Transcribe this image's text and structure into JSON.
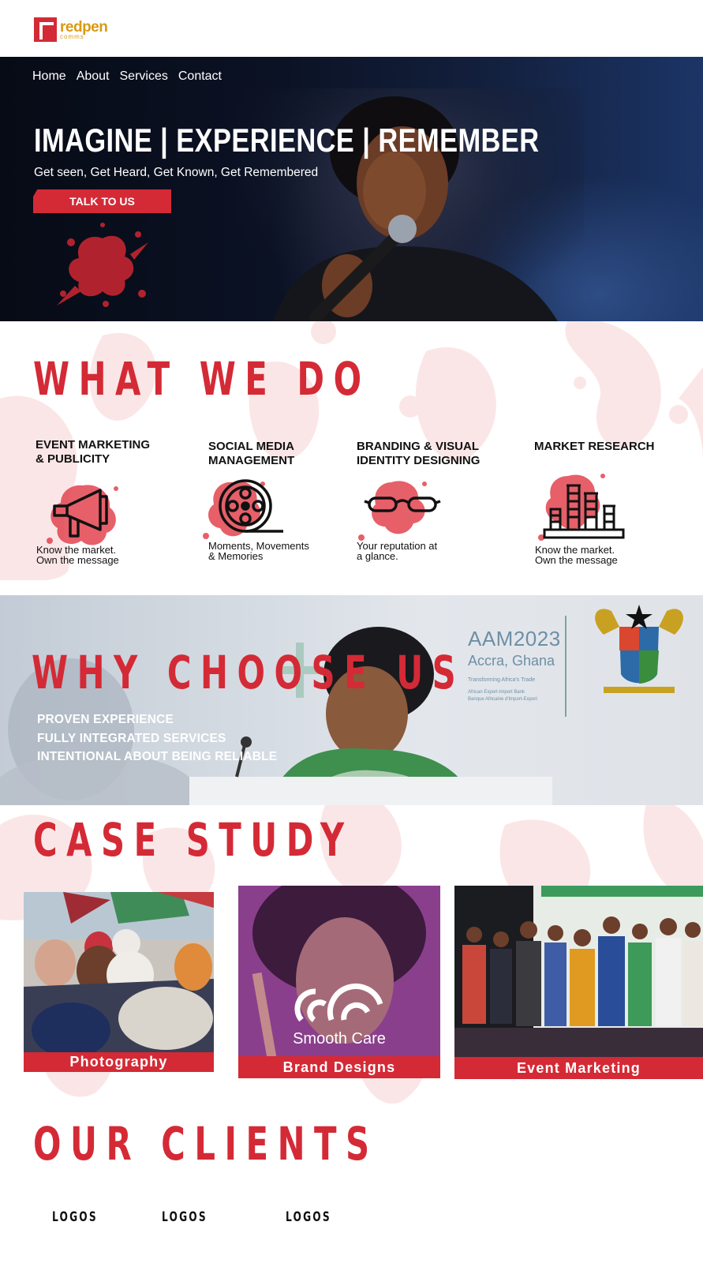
{
  "brand": {
    "logo_word": "redpen",
    "logo_sub": "comms"
  },
  "nav": {
    "items": [
      "Home",
      "About",
      "Services",
      "Contact"
    ]
  },
  "hero": {
    "title": "IMAGINE | EXPERIENCE | REMEMBER",
    "subtitle": "Get seen, Get Heard, Get Known, Get Remembered",
    "cta_label": "TALK TO US"
  },
  "what_we_do": {
    "title": "WHAT WE DO",
    "services": [
      {
        "title": "EVENT MARKETING\n& PUBLICITY",
        "icon": "megaphone-icon",
        "desc": "Know the market.\nOwn the message"
      },
      {
        "title": "SOCIAL MEDIA\nMANAGEMENT",
        "icon": "film-reel-icon",
        "desc": "Moments, Movements\n& Memories"
      },
      {
        "title": "BRANDING & VISUAL\nIDENTITY DESIGNING",
        "icon": "glasses-icon",
        "desc": "Your reputation at\na glance."
      },
      {
        "title": "MARKET RESEARCH",
        "icon": "bar-chart-icon",
        "desc": "Know the market.\nOwn the message"
      }
    ]
  },
  "why_choose_us": {
    "title": "WHY CHOOSE US",
    "points": [
      "PROVEN EXPERIENCE",
      "FULLY INTEGRATED SERVICES",
      "INTENTIONAL ABOUT BEING RELIABLE"
    ],
    "backdrop_text": [
      "AAM2023",
      "Accra, Ghana",
      "Transforming Africa's Trade",
      "African Export-Import Bank",
      "Banque Africaine d'Import-Export"
    ]
  },
  "case_study": {
    "title": "CASE STUDY",
    "cards": [
      {
        "label": "Photography"
      },
      {
        "label": "Brand Designs",
        "overlay_brand": "Smooth Care"
      },
      {
        "label": "Event Marketing"
      }
    ]
  },
  "clients": {
    "title": "OUR CLIENTS",
    "logos": [
      "LOGOS",
      "LOGOS",
      "LOGOS"
    ]
  },
  "colors": {
    "accent": "#d42a36",
    "gold": "#d99a12",
    "blob": "#f9e4e5",
    "brand_purple": "#8a3f8d"
  }
}
